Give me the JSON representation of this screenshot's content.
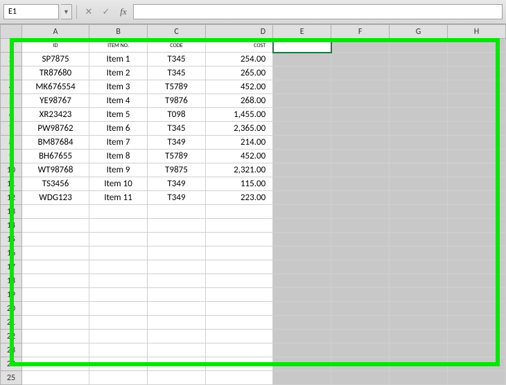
{
  "formula_bar": {
    "name_box": "E1",
    "cancel_label": "✕",
    "confirm_label": "✓",
    "fx_label": "fx",
    "formula_value": ""
  },
  "columns": [
    "A",
    "B",
    "C",
    "D",
    "E",
    "F",
    "G",
    "H"
  ],
  "row_count": 25,
  "active_cell": "E1",
  "headers": {
    "a": "ID",
    "b": "ITEM NO.",
    "c": "CODE",
    "d": "COST"
  },
  "rows": [
    {
      "id": "SP7875",
      "item": "Item 1",
      "code": "T345",
      "cost": "254.00"
    },
    {
      "id": "TR87680",
      "item": "Item 2",
      "code": "T345",
      "cost": "265.00"
    },
    {
      "id": "MK676554",
      "item": "Item 3",
      "code": "T5789",
      "cost": "452.00"
    },
    {
      "id": "YE98767",
      "item": "Item 4",
      "code": "T9876",
      "cost": "268.00"
    },
    {
      "id": "XR23423",
      "item": "Item 5",
      "code": "T098",
      "cost": "1,455.00"
    },
    {
      "id": "PW98762",
      "item": "Item 6",
      "code": "T345",
      "cost": "2,365.00"
    },
    {
      "id": "BM87684",
      "item": "Item 7",
      "code": "T349",
      "cost": "214.00"
    },
    {
      "id": "BH67655",
      "item": "Item 8",
      "code": "T5789",
      "cost": "452.00"
    },
    {
      "id": "WT98768",
      "item": "Item 9",
      "code": "T9875",
      "cost": "2,321.00"
    },
    {
      "id": "TS3456",
      "item": "Item 10",
      "code": "T349",
      "cost": "115.00"
    },
    {
      "id": "WDG123",
      "item": "Item 11",
      "code": "T349",
      "cost": "223.00"
    }
  ],
  "chart_data": {
    "type": "table",
    "title": "",
    "columns": [
      "ID",
      "ITEM NO.",
      "CODE",
      "COST"
    ],
    "records": [
      [
        "SP7875",
        "Item 1",
        "T345",
        254.0
      ],
      [
        "TR87680",
        "Item 2",
        "T345",
        265.0
      ],
      [
        "MK676554",
        "Item 3",
        "T5789",
        452.0
      ],
      [
        "YE98767",
        "Item 4",
        "T9876",
        268.0
      ],
      [
        "XR23423",
        "Item 5",
        "T098",
        1455.0
      ],
      [
        "PW98762",
        "Item 6",
        "T345",
        2365.0
      ],
      [
        "BM87684",
        "Item 7",
        "T349",
        214.0
      ],
      [
        "BH67655",
        "Item 8",
        "T5789",
        452.0
      ],
      [
        "WT98768",
        "Item 9",
        "T9875",
        2321.0
      ],
      [
        "TS3456",
        "Item 10",
        "T349",
        115.0
      ],
      [
        "WDG123",
        "Item 11",
        "T349",
        223.0
      ]
    ]
  }
}
